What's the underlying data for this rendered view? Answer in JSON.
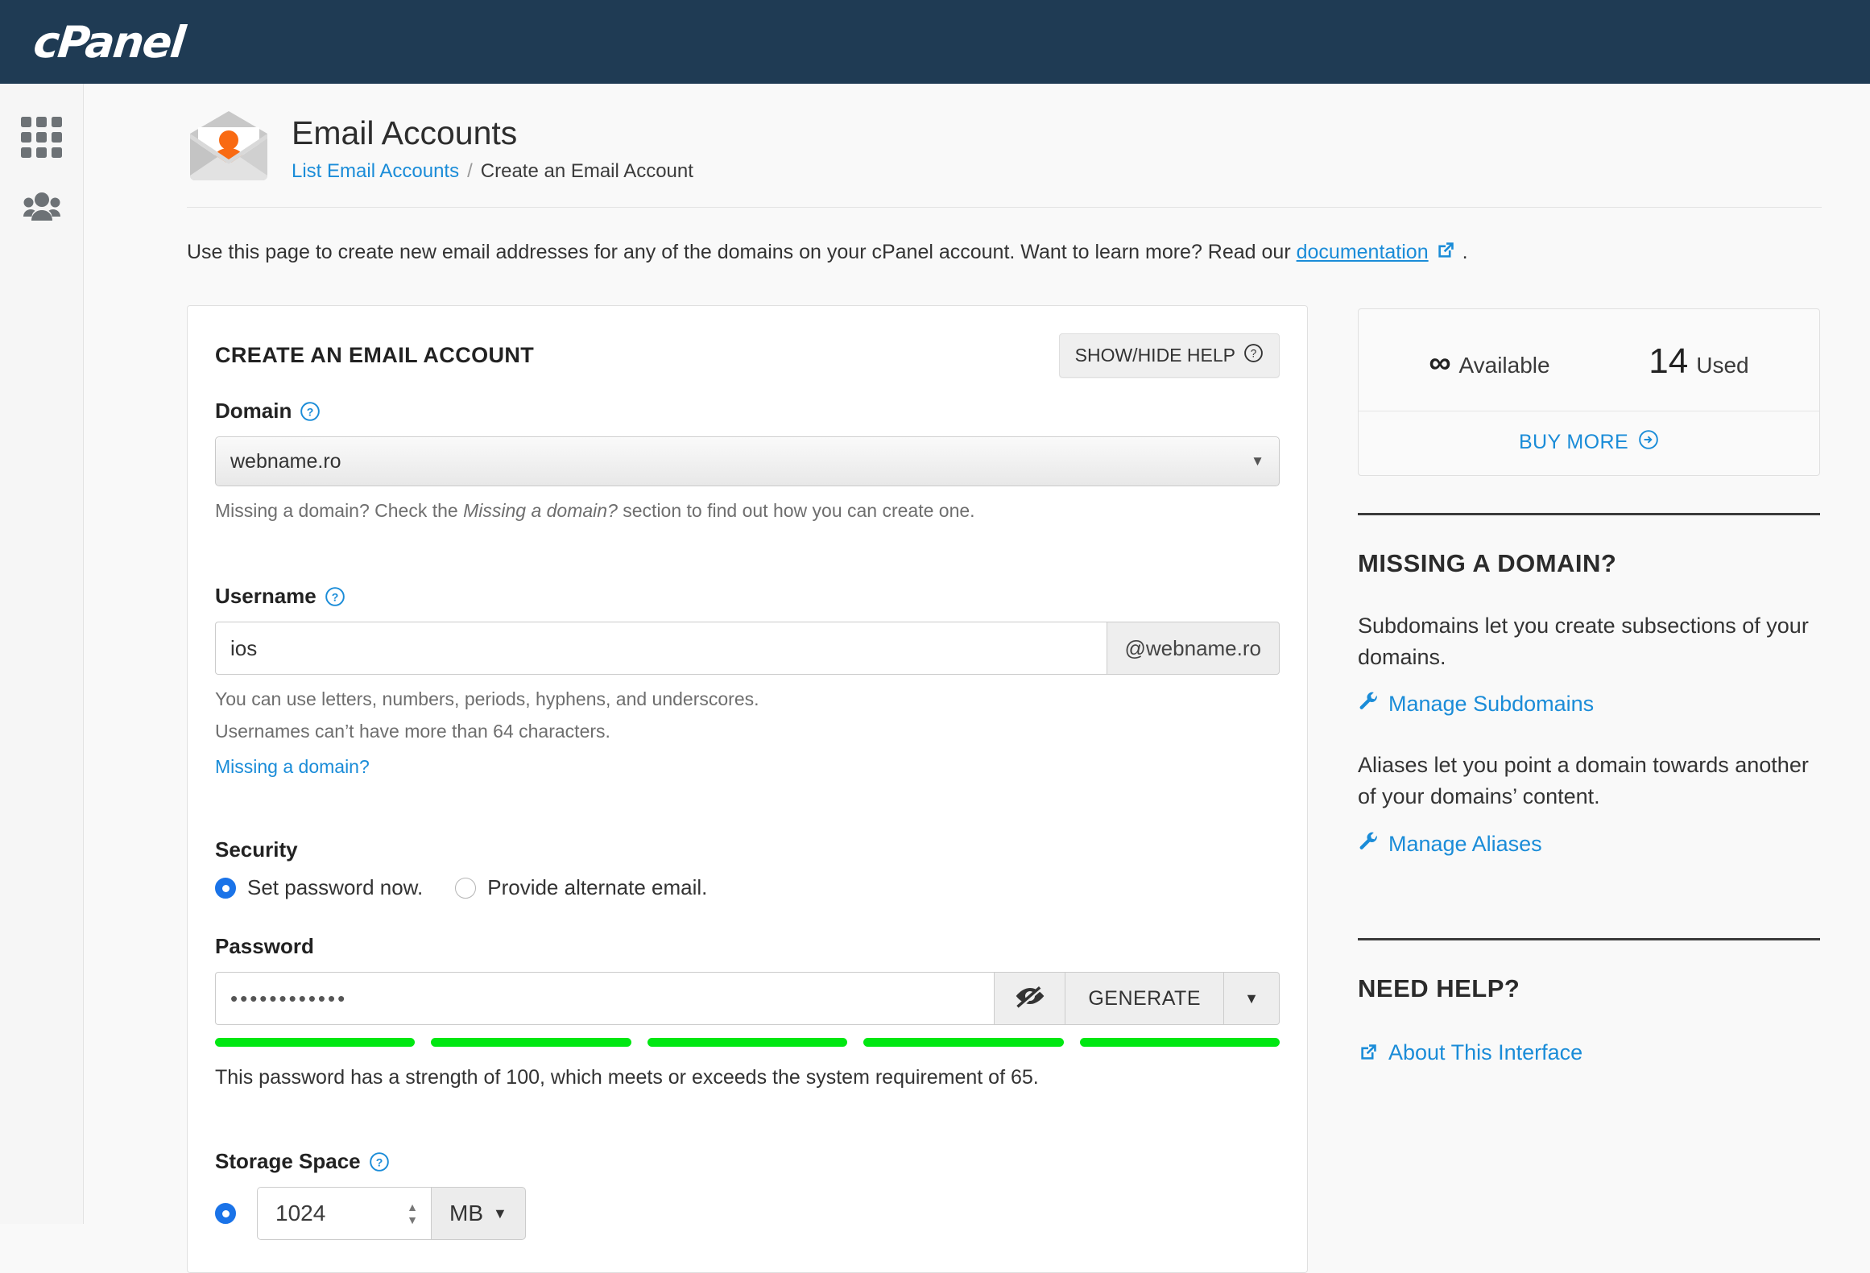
{
  "app": {
    "brand": "cPanel",
    "brand_bg": "#1f3b54",
    "accent": "#1a8cd8"
  },
  "sidebar": {
    "items": [
      {
        "name": "apps-grid",
        "icon": "grid-icon"
      },
      {
        "name": "user-manager",
        "icon": "users-icon"
      }
    ]
  },
  "header": {
    "title": "Email Accounts",
    "icon": "email-account-icon",
    "breadcrumb": {
      "link": "List Email Accounts",
      "separator": "/",
      "current": "Create an Email Account"
    }
  },
  "intro": {
    "before": "Use this page to create new email addresses for any of the domains on your cPanel account. Want to learn more? Read our ",
    "link": "documentation",
    "after": "."
  },
  "form": {
    "card_title": "CREATE AN EMAIL ACCOUNT",
    "help_button": "SHOW/HIDE HELP",
    "domain": {
      "label": "Domain",
      "value": "webname.ro",
      "hint_before": "Missing a domain? Check the ",
      "hint_em": "Missing a domain?",
      "hint_after": " section to find out how you can create one."
    },
    "username": {
      "label": "Username",
      "value": "ios",
      "addon": "@webname.ro",
      "hint1": "You can use letters, numbers, periods, hyphens, and underscores.",
      "hint2": "Usernames can’t have more than 64 characters.",
      "link": "Missing a domain?"
    },
    "security": {
      "label": "Security",
      "options": [
        {
          "label": "Set password now.",
          "selected": true
        },
        {
          "label": "Provide alternate email.",
          "selected": false
        }
      ]
    },
    "password": {
      "label": "Password",
      "value": "••••••••••••",
      "toggle_icon": "eye-slash-icon",
      "generate_label": "GENERATE",
      "caret_icon": "chevron-down-icon",
      "strength_segments": 5,
      "strength_color": "#00e712",
      "strength_text": "This password has a strength of 100, which meets or exceeds the system requirement of 65."
    },
    "storage": {
      "label": "Storage Space",
      "value": "1024",
      "unit": "MB",
      "selected": true
    }
  },
  "stats": {
    "available_value": "∞",
    "available_label": "Available",
    "used_value": "14",
    "used_label": "Used",
    "buy_more": "BUY MORE"
  },
  "missing_domain": {
    "heading": "MISSING A DOMAIN?",
    "paragraph1": "Subdomains let you create subsections of your domains.",
    "link1": "Manage Subdomains",
    "paragraph2": "Aliases let you point a domain towards another of your domains’ content.",
    "link2": "Manage Aliases"
  },
  "need_help": {
    "heading": "NEED HELP?",
    "link": "About This Interface"
  }
}
